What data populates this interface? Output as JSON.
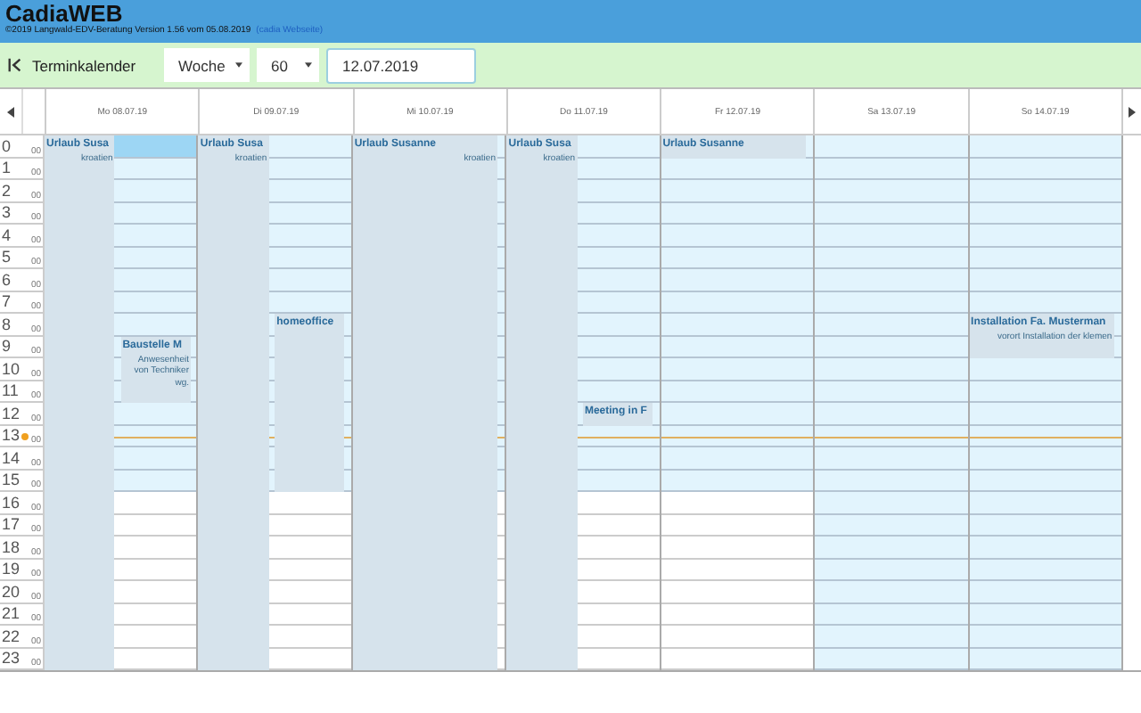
{
  "app": {
    "title": "CadiaWEB",
    "subtitle": "©2019 Langwald-EDV-Beratung Version 1.56 vom 05.08.2019",
    "link": "(cadia Webseite)"
  },
  "toolbar": {
    "title": "Terminkalender",
    "view": "Woche",
    "interval": "60",
    "date": "12.07.2019"
  },
  "hours": [
    {
      "hour": "0",
      "minute": "00"
    },
    {
      "hour": "1",
      "minute": "00"
    },
    {
      "hour": "2",
      "minute": "00"
    },
    {
      "hour": "3",
      "minute": "00"
    },
    {
      "hour": "4",
      "minute": "00"
    },
    {
      "hour": "5",
      "minute": "00"
    },
    {
      "hour": "6",
      "minute": "00"
    },
    {
      "hour": "7",
      "minute": "00"
    },
    {
      "hour": "8",
      "minute": "00"
    },
    {
      "hour": "9",
      "minute": "00"
    },
    {
      "hour": "10",
      "minute": "00"
    },
    {
      "hour": "11",
      "minute": "00"
    },
    {
      "hour": "12",
      "minute": "00"
    },
    {
      "hour": "13",
      "minute": "00"
    },
    {
      "hour": "14",
      "minute": "00"
    },
    {
      "hour": "15",
      "minute": "00"
    },
    {
      "hour": "16",
      "minute": "00"
    },
    {
      "hour": "17",
      "minute": "00"
    },
    {
      "hour": "18",
      "minute": "00"
    },
    {
      "hour": "19",
      "minute": "00"
    },
    {
      "hour": "20",
      "minute": "00"
    },
    {
      "hour": "21",
      "minute": "00"
    },
    {
      "hour": "22",
      "minute": "00"
    },
    {
      "hour": "23",
      "minute": "00"
    }
  ],
  "days": [
    {
      "label": "Mo 08.07.19",
      "weekend": false,
      "selected": true,
      "events": [
        {
          "title": "Urlaub Susa",
          "note": "kroatien",
          "kind": "left"
        },
        {
          "title": "Baustelle M",
          "note": "Anwesenheit von Techniker wg.",
          "kind": "right"
        }
      ]
    },
    {
      "label": "Di 09.07.19",
      "weekend": false,
      "selected": false,
      "events": [
        {
          "title": "Urlaub Susa",
          "note": "kroatien",
          "kind": "left"
        },
        {
          "title": "homeoffice",
          "kind": "right"
        }
      ]
    },
    {
      "label": "Mi 10.07.19",
      "weekend": false,
      "selected": false,
      "events": [
        {
          "title": "Urlaub Susanne",
          "note": "kroatien",
          "kind": "full"
        }
      ]
    },
    {
      "label": "Do 11.07.19",
      "weekend": false,
      "selected": false,
      "events": [
        {
          "title": "Urlaub Susa",
          "note": "kroatien",
          "kind": "left"
        },
        {
          "title": "Meeting in F",
          "kind": "right"
        }
      ]
    },
    {
      "label": "Fr 12.07.19",
      "weekend": false,
      "selected": false,
      "events": [
        {
          "title": "Urlaub Susanne",
          "kind": "full"
        }
      ]
    },
    {
      "label": "Sa 13.07.19",
      "weekend": true,
      "selected": false
    },
    {
      "label": "So 14.07.19",
      "weekend": true,
      "selected": false,
      "events": [
        {
          "title": "Installation Fa. Musterman",
          "note": "vorort Installation der klemen",
          "kind": "full"
        }
      ]
    }
  ]
}
